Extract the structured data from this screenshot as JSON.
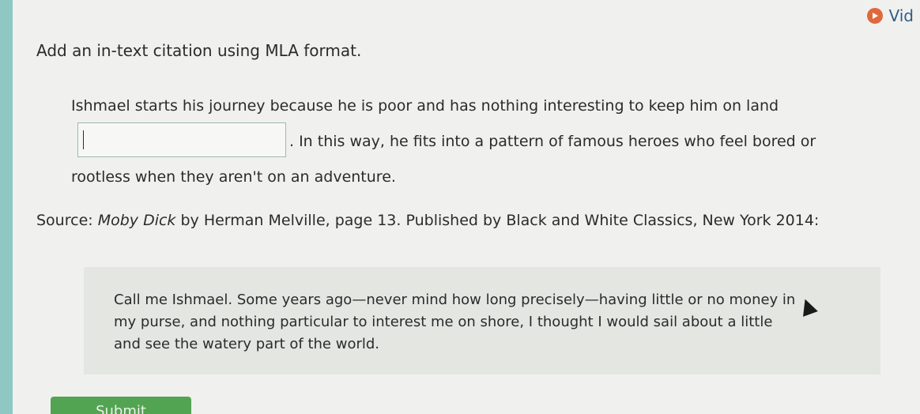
{
  "header": {
    "video_label": "Vid",
    "video_icon": "play-icon"
  },
  "instruction": "Add an in-text citation using MLA format.",
  "passage": {
    "before": "Ishmael starts his journey because he is poor and has nothing interesting to keep him on land",
    "input_value": "",
    "after": ". In this way, he fits into a pattern of famous heroes who feel bored or rootless when they aren't on an adventure."
  },
  "source": {
    "prefix": "Source: ",
    "title": "Moby Dick",
    "suffix": " by Herman Melville, page 13. Published by Black and White Classics, New York 2014:"
  },
  "quote": "Call me Ishmael. Some years ago—never mind how long precisely—having little or no money in my purse, and nothing particular to interest me on shore, I thought I would sail about a little and see the watery part of the world.",
  "submit_label": "Submit",
  "colors": {
    "accent_green": "#53a452",
    "left_strip": "#8fc8c3",
    "video_icon": "#e0683d"
  }
}
